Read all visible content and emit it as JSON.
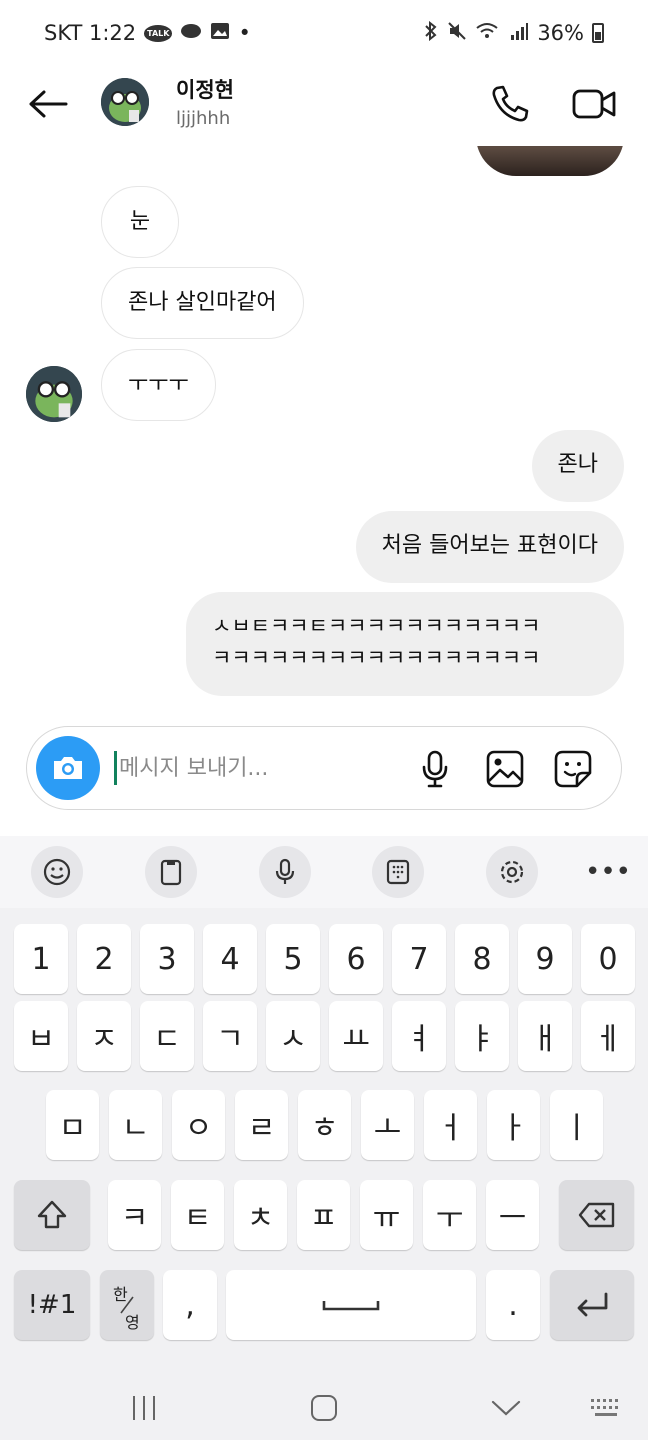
{
  "status_bar": {
    "carrier_time": "SKT 1:22",
    "talk_badge": "TALK",
    "dot": "•",
    "battery": "36%"
  },
  "header": {
    "name": "이정현",
    "handle": "ljjjhhh"
  },
  "messages": [
    {
      "side": "in",
      "text": "눈"
    },
    {
      "side": "in",
      "text": "존나 살인마같어"
    },
    {
      "side": "in",
      "text": "ㅜㅜㅜ"
    },
    {
      "side": "out",
      "text": "존나"
    },
    {
      "side": "out",
      "text": "처음 들어보는 표현이다"
    },
    {
      "side": "out",
      "text": "ㅅㅂㅌㅋㅋㅌㅋㅋㅋㅋㅋㅋㅋㅋㅋㅋㅋ\nㅋㅋㅋㅋㅋㅋㅋㅋㅋㅋㅋㅋㅋㅋㅋㅋㅋ"
    }
  ],
  "composer": {
    "placeholder": "메시지 보내기..."
  },
  "keyboard": {
    "numbers": [
      "1",
      "2",
      "3",
      "4",
      "5",
      "6",
      "7",
      "8",
      "9",
      "0"
    ],
    "row1": [
      "ㅂ",
      "ㅈ",
      "ㄷ",
      "ㄱ",
      "ㅅ",
      "ㅛ",
      "ㅕ",
      "ㅑ",
      "ㅐ",
      "ㅔ"
    ],
    "row2": [
      "ㅁ",
      "ㄴ",
      "ㅇ",
      "ㄹ",
      "ㅎ",
      "ㅗ",
      "ㅓ",
      "ㅏ",
      "ㅣ"
    ],
    "row3": [
      "ㅋ",
      "ㅌ",
      "ㅊ",
      "ㅍ",
      "ㅠ",
      "ㅜ",
      "ㅡ"
    ],
    "symbols": "!#1",
    "han": "한",
    "yeong": "영",
    "comma": ",",
    "period": "."
  },
  "colors": {
    "accent_blue": "#2c9cf5",
    "caret_green": "#12825d",
    "bubble_out": "#efefef",
    "keyboard_bg": "#f1f1f3"
  }
}
